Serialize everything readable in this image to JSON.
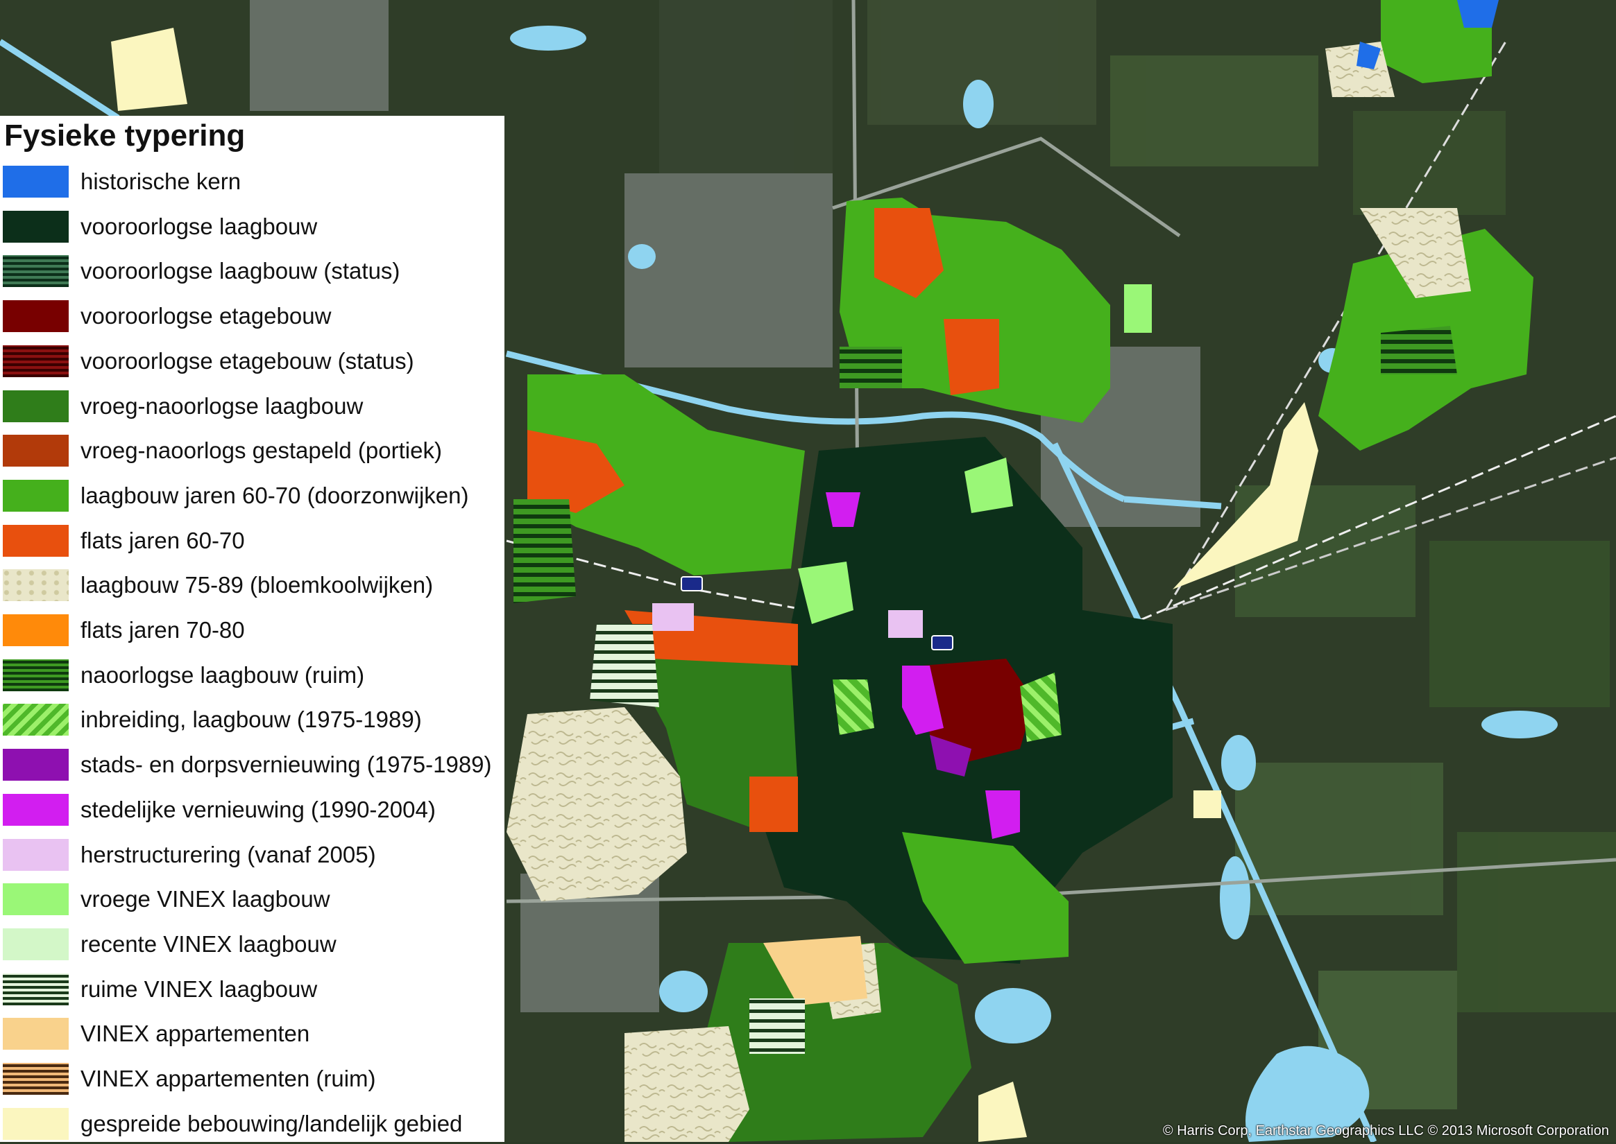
{
  "map": {
    "credits": "© Harris Corp, Earthstar Geographics LLC © 2013 Microsoft Corporation"
  },
  "legend": {
    "title": "Fysieke typering",
    "items": [
      {
        "label": "historische kern",
        "color": "#1f6ee8",
        "pattern": "solid",
        "icon": "historische-kern"
      },
      {
        "label": "vooroorlogse laagbouw",
        "color": "#0c2f1a",
        "pattern": "solid",
        "icon": "vooroorlogse-laagbouw"
      },
      {
        "label": "vooroorlogse laagbouw (status)",
        "color": "#0c2f1a",
        "pattern": "stripes",
        "stripe_bg": "#3f7a55",
        "icon": "vooroorlogse-laagbouw-status"
      },
      {
        "label": "vooroorlogse etagebouw",
        "color": "#780000",
        "pattern": "solid",
        "icon": "vooroorlogse-etagebouw"
      },
      {
        "label": "vooroorlogse etagebouw (status)",
        "color": "#3a0000",
        "pattern": "stripes",
        "stripe_bg": "#8a1010",
        "icon": "vooroorlogse-etagebouw-status"
      },
      {
        "label": "vroeg-naoorlogse laagbouw",
        "color": "#2f7d1a",
        "pattern": "solid",
        "icon": "vroeg-naoorlogse-laagbouw"
      },
      {
        "label": "vroeg-naoorlogs gestapeld (portiek)",
        "color": "#b23a0a",
        "pattern": "solid",
        "icon": "vroeg-naoorlogs-gestapeld"
      },
      {
        "label": "laagbouw jaren 60-70 (doorzonwijken)",
        "color": "#45b01c",
        "pattern": "solid",
        "icon": "laagbouw-60-70"
      },
      {
        "label": "flats jaren 60-70",
        "color": "#e8500e",
        "pattern": "solid",
        "icon": "flats-60-70"
      },
      {
        "label": "laagbouw 75-89 (bloemkoolwijken)",
        "color": "#e9e6c9",
        "pattern": "blobs",
        "stripe_bg": "#cfcaa0",
        "icon": "laagbouw-75-89"
      },
      {
        "label": "flats jaren 70-80",
        "color": "#ff8a0a",
        "pattern": "solid",
        "icon": "flats-70-80"
      },
      {
        "label": "naoorlogse laagbouw (ruim)",
        "color": "#0f3a0f",
        "pattern": "stripes",
        "stripe_bg": "#3e9a22",
        "icon": "naoorlogse-laagbouw-ruim"
      },
      {
        "label": "inbreiding, laagbouw (1975-1989)",
        "color": "#9cf06a",
        "pattern": "diagonal",
        "stripe_bg": "#4fb82a",
        "icon": "inbreiding-laagbouw"
      },
      {
        "label": "stads- en dorpsvernieuwing (1975-1989)",
        "color": "#8e10b0",
        "pattern": "solid",
        "icon": "stads-dorpsvernieuwing"
      },
      {
        "label": "stedelijke vernieuwing (1990-2004)",
        "color": "#d21ef0",
        "pattern": "solid",
        "icon": "stedelijke-vernieuwing"
      },
      {
        "label": "herstructurering (vanaf 2005)",
        "color": "#e9c2f2",
        "pattern": "solid",
        "icon": "herstructurering"
      },
      {
        "label": "vroege VINEX laagbouw",
        "color": "#9af777",
        "pattern": "solid",
        "icon": "vroege-vinex-laagbouw"
      },
      {
        "label": "recente VINEX laagbouw",
        "color": "#d3f7c8",
        "pattern": "solid",
        "icon": "recente-vinex-laagbouw"
      },
      {
        "label": "ruime VINEX laagbouw",
        "color": "#1a3a1a",
        "pattern": "stripes",
        "stripe_bg": "#e4f4dc",
        "icon": "ruime-vinex-laagbouw"
      },
      {
        "label": "VINEX appartementen",
        "color": "#f9d28c",
        "pattern": "solid",
        "icon": "vinex-appartementen"
      },
      {
        "label": "VINEX appartementen (ruim)",
        "color": "#4a2a10",
        "pattern": "stripes",
        "stripe_bg": "#f1b978",
        "icon": "vinex-appartementen-ruim"
      },
      {
        "label": "gespreide bebouwing/landelijk gebied",
        "color": "#fbf6bf",
        "pattern": "solid",
        "icon": "gespreide-bebouwing"
      }
    ]
  }
}
